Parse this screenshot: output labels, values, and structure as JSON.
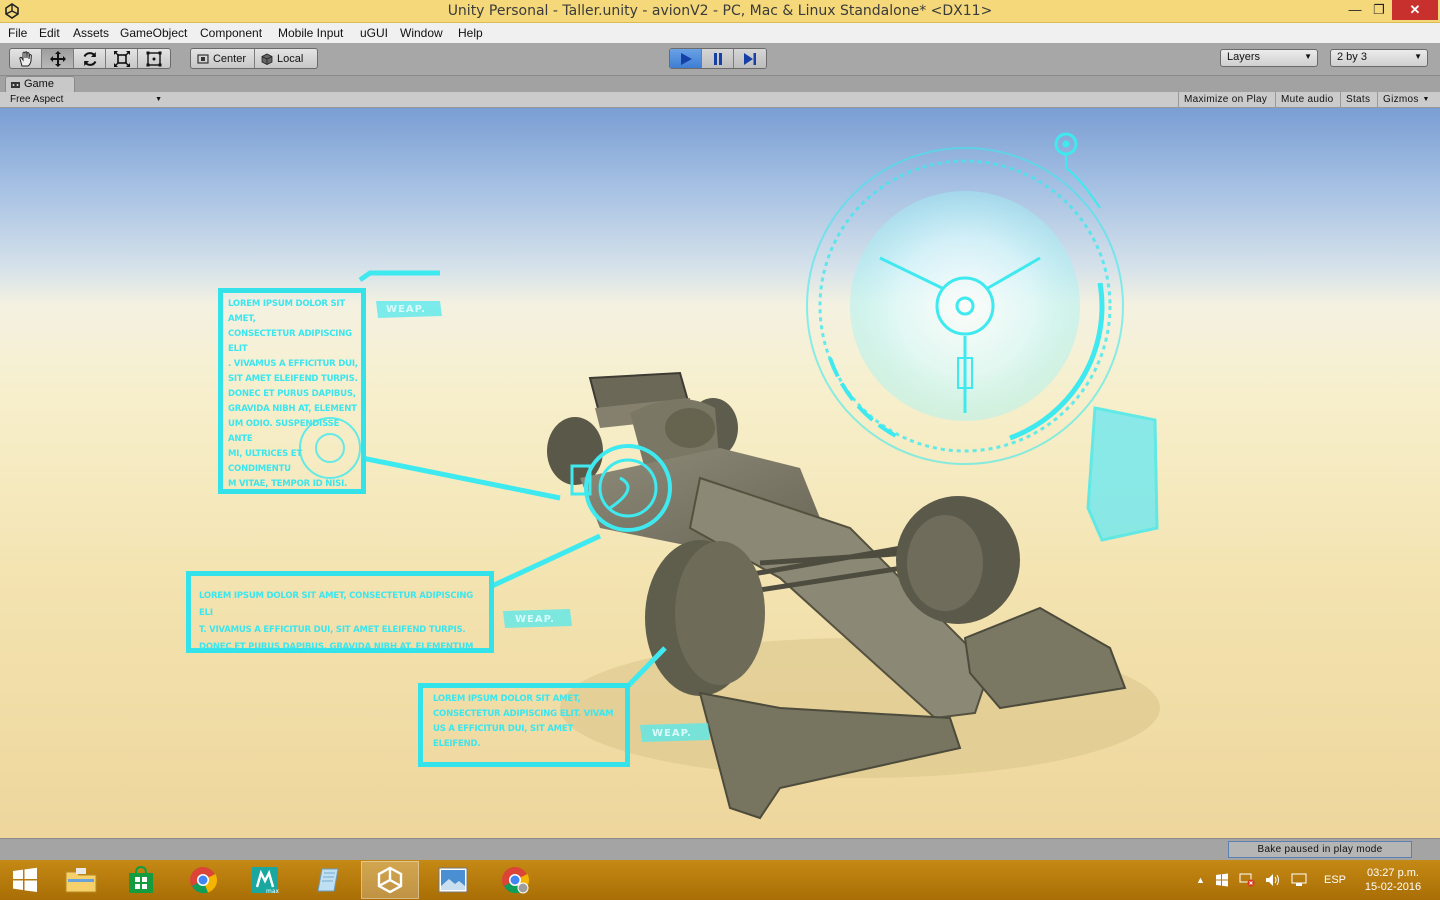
{
  "window": {
    "title": "Unity Personal - Taller.unity - avionV2 - PC, Mac & Linux Standalone* <DX11>",
    "controls": {
      "minimize": "—",
      "maximize": "❐",
      "close": "✕"
    }
  },
  "menu": [
    "File",
    "Edit",
    "Assets",
    "GameObject",
    "Component",
    "Mobile Input",
    "uGUI",
    "Window",
    "Help"
  ],
  "toolbar": {
    "tools": [
      "hand-icon",
      "move-icon",
      "rotate-icon",
      "scale-icon",
      "rect-icon"
    ],
    "active_tool": "move-icon",
    "pivot_label": "Center",
    "space_label": "Local",
    "play_controls": [
      "play-icon",
      "pause-icon",
      "step-icon"
    ],
    "playing": true,
    "layers_label": "Layers",
    "layout_label": "2 by 3"
  },
  "game_panel": {
    "tab_label": "Game",
    "aspect_label": "Free Aspect",
    "buttons": [
      "Maximize on Play",
      "Mute audio",
      "Stats",
      "Gizmos"
    ]
  },
  "hud": {
    "box1_lines": [
      "LOREM IPSUM DOLOR SIT AMET,",
      "CONSECTETUR ADIPISCING ELIT",
      ". VIVAMUS A EFFICITUR DUI,",
      "SIT AMET ELEIFEND TURPIS.",
      "DONEC ET PURUS DAPIBUS,",
      "GRAVIDA NIBH AT, ELEMENT",
      "UM ODIO. SUSPENDISSE ANTE",
      "MI, ULTRICES ET CONDIMENTU",
      "M VITAE, TEMPOR ID NISI."
    ],
    "box2_lines": [
      "LOREM IPSUM DOLOR SIT AMET, CONSECTETUR ADIPISCING ELI",
      "T. VIVAMUS A EFFICITUR DUI, SIT AMET ELEIFEND TURPIS.",
      "DONEC ET PURUS DAPIBUS, GRAVIDA NIBH AT, ELEMENTUM"
    ],
    "box3_lines": [
      "LOREM IPSUM DOLOR SIT AMET,",
      "CONSECTETUR ADIPISCING ELIT. VIVAM",
      "US A EFFICITUR DUI, SIT AMET ELEIFEND."
    ],
    "weap_label": "WEAP.",
    "accent_color": "#34e3ea"
  },
  "status": {
    "bake_label": "Bake paused in play mode"
  },
  "taskbar": {
    "apps": [
      "windows-start-icon",
      "file-explorer-icon",
      "store-icon",
      "chrome-icon",
      "3ds-max-icon",
      "notepad-icon",
      "unity-icon",
      "photos-icon",
      "chrome-alt-icon"
    ],
    "active_app": "unity-icon",
    "language": "ESP",
    "time": "03:27 p.m.",
    "date": "15-02-2016"
  }
}
